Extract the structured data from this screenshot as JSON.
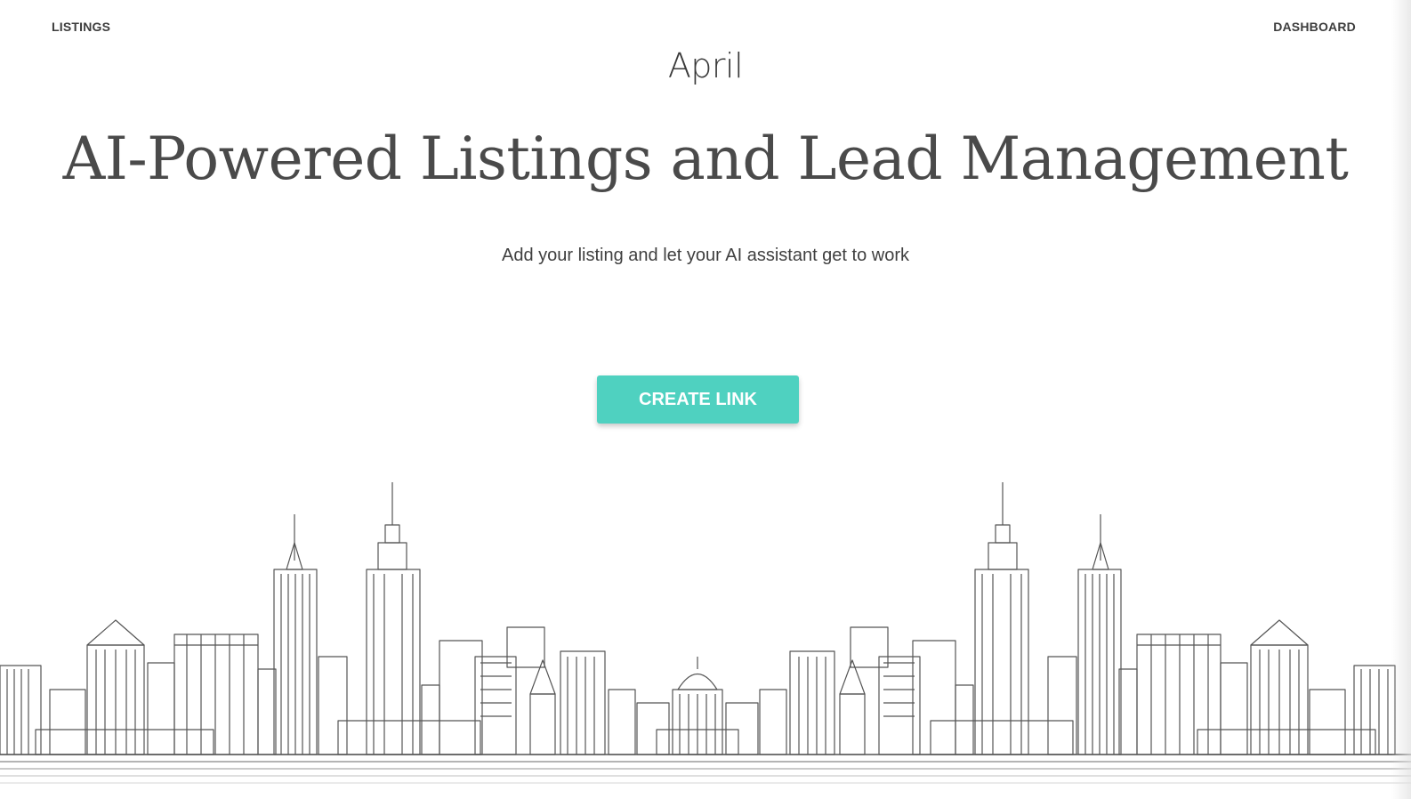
{
  "nav": {
    "left_link": "LISTINGS",
    "right_link": "DASHBOARD"
  },
  "brand": {
    "logo_text": "April"
  },
  "hero": {
    "headline": "AI-Powered Listings and Lead Management",
    "subheadline": "Add your listing and let your AI assistant get to work",
    "cta_label": "CREATE LINK"
  },
  "colors": {
    "accent": "#4fd1c0",
    "text": "#4a4a4a",
    "background": "#ffffff",
    "sketch_line": "#555555"
  },
  "illustration": {
    "type": "city-skyline-sketch"
  }
}
